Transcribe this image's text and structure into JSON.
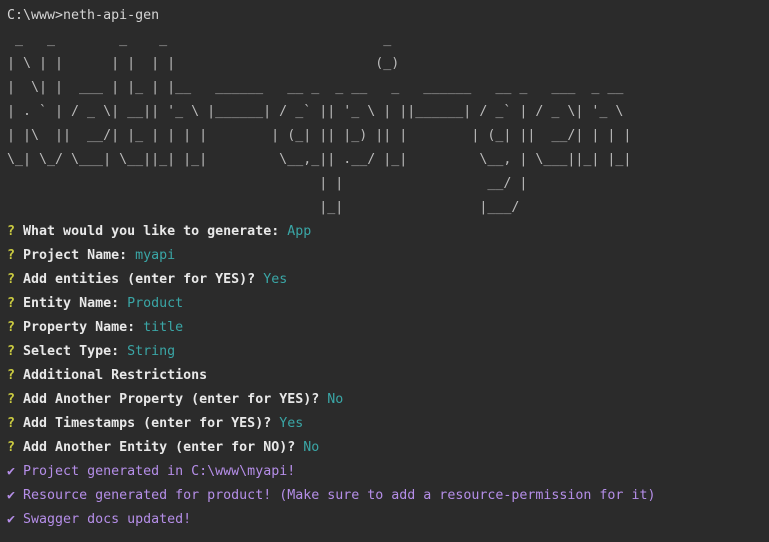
{
  "command_prompt": "C:\\www>neth-api-gen",
  "banner_lines": [
    " _   _        _    _                           _",
    "| \\ | |      | |  | |                         (_)",
    "|  \\| |  ___ | |_ | |__   ______   __ _  _ __   _   ______   __ _   ___  _ __",
    "| . ` | / _ \\| __|| '_ \\ |______| / _` || '_ \\ | ||______| / _` | / _ \\| '_ \\",
    "| |\\  ||  __/| |_ | | | |        | (_| || |_) || |        | (_| ||  __/| | | |",
    "\\_| \\_/ \\___| \\__||_| |_|         \\__,_|| .__/ |_|         \\__, | \\___||_| |_|",
    "                                       | |                  __/ |",
    "                                       |_|                 |___/"
  ],
  "prompts": [
    {
      "mark": "?",
      "question": "What would you like to generate:",
      "answer": "App"
    },
    {
      "mark": "?",
      "question": "Project Name:",
      "answer": "myapi"
    },
    {
      "mark": "?",
      "question": "Add entities (enter for YES)?",
      "answer": "Yes"
    },
    {
      "mark": "?",
      "question": "Entity Name:",
      "answer": "Product"
    },
    {
      "mark": "?",
      "question": "Property Name:",
      "answer": "title"
    },
    {
      "mark": "?",
      "question": "Select Type:",
      "answer": "String"
    },
    {
      "mark": "?",
      "question": "Additional Restrictions",
      "answer": ""
    },
    {
      "mark": "?",
      "question": "Add Another Property (enter for YES)?",
      "answer": "No"
    },
    {
      "mark": "?",
      "question": "Add Timestamps (enter for YES)?",
      "answer": "Yes"
    },
    {
      "mark": "?",
      "question": "Add Another Entity (enter for NO)?",
      "answer": "No"
    }
  ],
  "results": [
    {
      "mark": "✔",
      "text": "Project generated in C:\\www\\myapi!"
    },
    {
      "mark": "✔",
      "text": "Resource generated for product! (Make sure to add a resource-permission for it)"
    },
    {
      "mark": "✔",
      "text": "Swagger docs updated!"
    }
  ],
  "colors": {
    "background": "#2b2b2b",
    "question_mark": "#cbcb41",
    "answer": "#3aa6a6",
    "success": "#b58ee8"
  }
}
